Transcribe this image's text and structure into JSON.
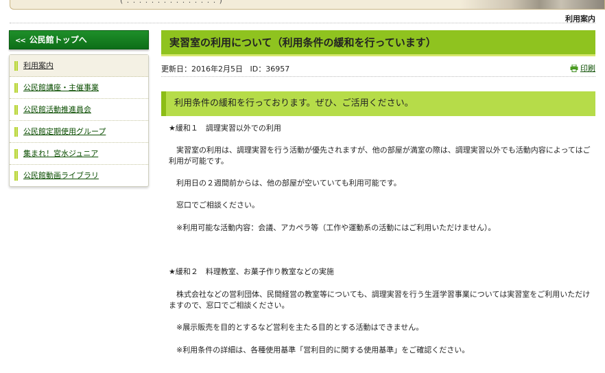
{
  "banner": {
    "partial_text": "( . . . . . . . . . . . . . . . )"
  },
  "breadcrumb": {
    "current": "利用案内"
  },
  "sidebar": {
    "top_link": {
      "arrow": "<<",
      "label": "公民館トップへ"
    },
    "items": [
      {
        "label": "利用案内"
      },
      {
        "label": "公民館講座・主催事業"
      },
      {
        "label": "公民館活動推進員会"
      },
      {
        "label": "公民館定期使用グループ"
      },
      {
        "label": "集まれ！宮水ジュニア"
      },
      {
        "label": "公民館動画ライブラリ"
      }
    ]
  },
  "article": {
    "title": "実習室の利用について（利用条件の緩和を行っています）",
    "updated_label": "更新日：2016年2月5日",
    "id_label": "ID：36957",
    "print_label": "印刷",
    "sub_heading": "利用条件の緩和を行っております。ぜひ、ご活用ください。",
    "paragraphs": [
      "★緩和１　調理実習以外での利用",
      "実習室の利用は、調理実習を行う活動が優先されますが、他の部屋が満室の際は、調理実習以外でも活動内容によってはご利用が可能です。",
      "利用日の２週間前からは、他の部屋が空いていても利用可能です。",
      "窓口でご相談ください。",
      "※利用可能な活動内容：会議、アカペラ等（工作や運動系の活動にはご利用いただけません）。",
      "★緩和２　料理教室、お菓子作り教室などの実施",
      "株式会社などの営利団体、民間経営の教室等についても、調理実習を行う生涯学習事業については実習室をご利用いただけますので、窓口でご相談ください。",
      "※展示販売を目的とするなど営利を主たる目的とする活動はできません。",
      "※利用条件の詳細は、各種使用基準「営利目的に関する使用基準」をご確認ください。"
    ]
  },
  "colors": {
    "title_bar": "#8fc31f",
    "sub_heading": "#b6dc49",
    "side_top": "#0d6e18",
    "link": "#0a4d00"
  }
}
